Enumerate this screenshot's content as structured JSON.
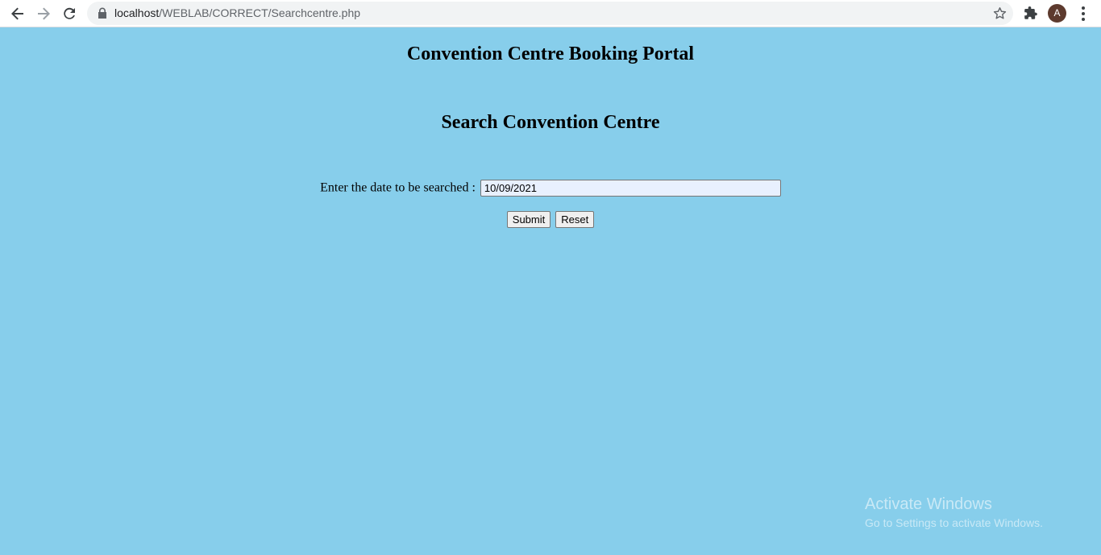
{
  "browser": {
    "url_host": "localhost",
    "url_path": "/WEBLAB/CORRECT/Searchcentre.php",
    "profile_initial": "A",
    "icons": {
      "back": "arrow-left-icon",
      "forward": "arrow-right-icon",
      "reload": "reload-icon",
      "lock": "lock-icon",
      "bookmark": "star-icon",
      "extensions": "puzzle-icon",
      "menu": "kebab-menu-icon"
    }
  },
  "page": {
    "background_color": "#87ceeb",
    "portal_title": "Convention Centre Booking Portal",
    "search_title": "Search Convention Centre",
    "form": {
      "date_label": "Enter the date to be searched :",
      "date_value": "10/09/2021",
      "submit_label": "Submit",
      "reset_label": "Reset"
    }
  },
  "watermark": {
    "title": "Activate Windows",
    "subtitle": "Go to Settings to activate Windows."
  }
}
